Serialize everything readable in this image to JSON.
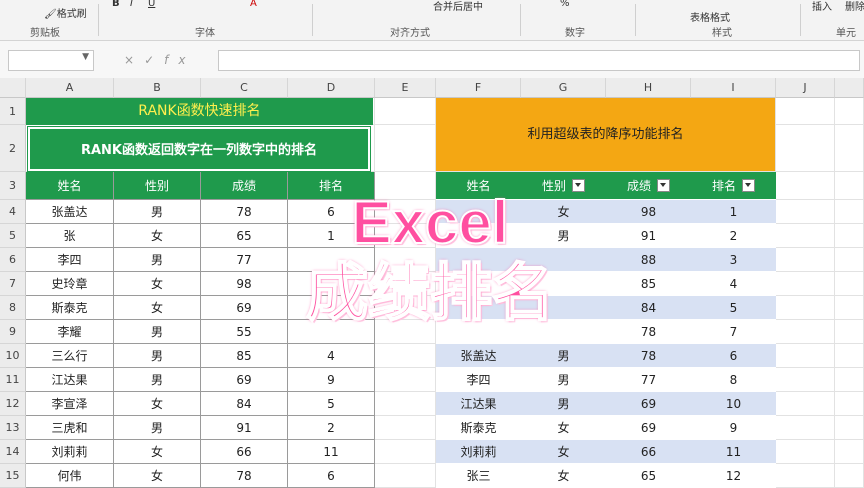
{
  "ribbon": {
    "items": [
      "格式刷",
      "B",
      "I",
      "U",
      "A",
      "合并后居中",
      "%",
      "表格格式",
      "插入",
      "删除",
      "单元格"
    ],
    "groups": [
      "剪贴板",
      "字体",
      "对齐方式",
      "数字",
      "样式",
      "单元"
    ]
  },
  "formula_bar": {
    "name_box": "",
    "icons": [
      "×",
      "✓",
      "fx"
    ],
    "content": ""
  },
  "columns": [
    "A",
    "B",
    "C",
    "D",
    "E",
    "F",
    "G",
    "H",
    "I",
    "J"
  ],
  "rows": [
    "1",
    "2",
    "3",
    "4",
    "5",
    "6",
    "7",
    "8",
    "9",
    "10",
    "11",
    "12",
    "13",
    "14",
    "15"
  ],
  "left_table": {
    "title": "RANK函数快速排名",
    "subtitle": "RANK函数返回数字在一列数字中的排名",
    "headers": [
      "姓名",
      "性别",
      "成绩",
      "排名"
    ],
    "rows": [
      [
        "张盖达",
        "男",
        "78",
        "6"
      ],
      [
        "张",
        "女",
        "65",
        "1"
      ],
      [
        "李四",
        "男",
        "77",
        ""
      ],
      [
        "史玲章",
        "女",
        "98",
        ""
      ],
      [
        "斯泰克",
        "女",
        "69",
        ""
      ],
      [
        "李耀",
        "男",
        "55",
        ""
      ],
      [
        "三么行",
        "男",
        "85",
        "4"
      ],
      [
        "江达果",
        "男",
        "69",
        "9"
      ],
      [
        "李宣泽",
        "女",
        "84",
        "5"
      ],
      [
        "三虎和",
        "男",
        "91",
        "2"
      ],
      [
        "刘莉莉",
        "女",
        "66",
        "11"
      ],
      [
        "何伟",
        "女",
        "78",
        "6"
      ]
    ]
  },
  "right_table": {
    "title": "利用超级表的降序功能排名",
    "headers": [
      "姓名",
      "性别",
      "成绩",
      "排名"
    ],
    "rows": [
      [
        "",
        "女",
        "98",
        "1"
      ],
      [
        "",
        "男",
        "91",
        "2"
      ],
      [
        "",
        "",
        "88",
        "3"
      ],
      [
        "",
        "",
        "85",
        "4"
      ],
      [
        "",
        "",
        "84",
        "5"
      ],
      [
        "",
        "",
        "78",
        "7"
      ],
      [
        "张盖达",
        "男",
        "78",
        "6"
      ],
      [
        "李四",
        "男",
        "77",
        "8"
      ],
      [
        "江达果",
        "男",
        "69",
        "10"
      ],
      [
        "斯泰克",
        "女",
        "69",
        "9"
      ],
      [
        "刘莉莉",
        "女",
        "66",
        "11"
      ],
      [
        "张三",
        "女",
        "65",
        "12"
      ]
    ]
  },
  "overlay": {
    "line1": "Excel",
    "line2": "成绩排名",
    "color": "#ff4fa0"
  },
  "colors": {
    "green_header": "#1f9a4c",
    "orange_title": "#f4a713",
    "band_blue": "#d8e1f3"
  }
}
